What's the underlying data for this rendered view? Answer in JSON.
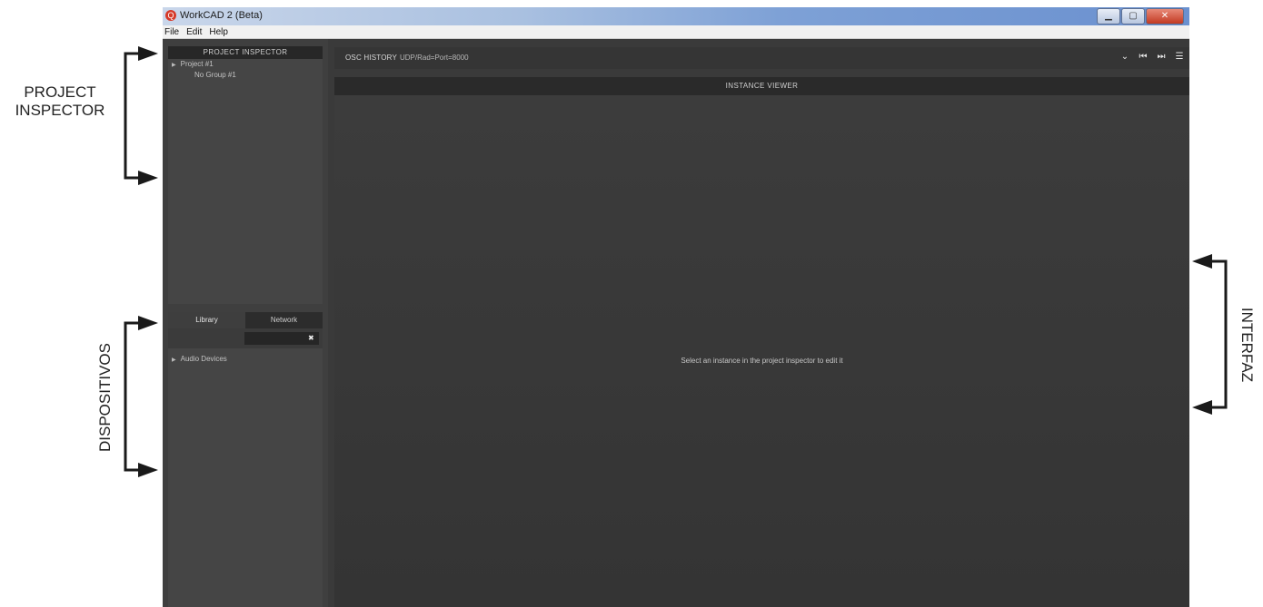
{
  "annotations": {
    "project_inspector": "PROJECT\nINSPECTOR",
    "dispositivos": "DISPOSITIVOS",
    "interfaz": "INTERFAZ"
  },
  "window": {
    "title": "WorkCAD 2 (Beta)",
    "icon_glyph": "Q",
    "controls": {
      "minimize": "▁",
      "maximize": "▢",
      "close": "✕"
    }
  },
  "menu": [
    "File",
    "Edit",
    "Help"
  ],
  "project_inspector": {
    "header": "PROJECT INSPECTOR",
    "items": [
      {
        "label": "Project #1",
        "child": false
      },
      {
        "label": "No Group #1",
        "child": true
      }
    ]
  },
  "devices": {
    "tabs": [
      "Library",
      "Network"
    ],
    "active_tab": "Library",
    "search_value": "",
    "clear_glyph": "✖",
    "items": [
      "Audio Devices"
    ]
  },
  "osc": {
    "label": "OSC HISTORY",
    "udp": "UDP/Rad=Port=8000",
    "icons": [
      "chevron-down-icon",
      "play-back-icon",
      "play-forward-icon",
      "menu-icon"
    ],
    "icon_glyphs": [
      "⌄",
      "⏮",
      "⏭",
      "☰"
    ]
  },
  "instance_viewer": {
    "header": "INSTANCE VIEWER",
    "message": "Select an instance in the project inspector to edit it"
  },
  "colors": {
    "window_bg": "#3a3a3a",
    "header_bg": "#272727",
    "accent_icon": "#d63a2a",
    "annotation": "#222222"
  }
}
